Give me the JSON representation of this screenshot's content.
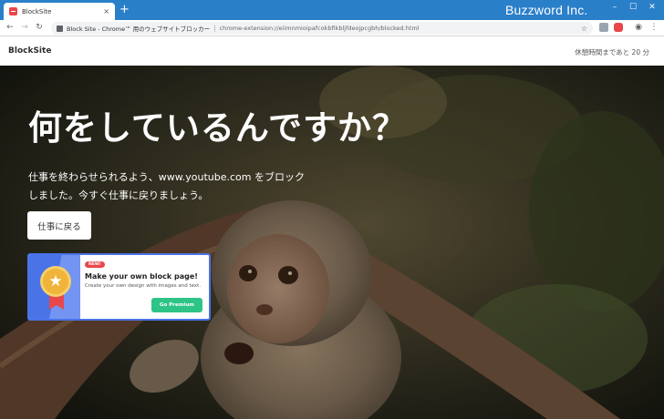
{
  "browser": {
    "tab_title": "BlockSite",
    "tab_close": "×",
    "new_tab": "+",
    "brand": "Buzzword Inc.",
    "window_controls": {
      "minimize": "–",
      "maximize": "☐",
      "close": "✕"
    },
    "nav": {
      "back": "←",
      "forward": "→",
      "reload": "↻"
    },
    "omnibox": {
      "site_label": "Block Site - Chrome™ 用のウェブサイトブロッカー",
      "separator": "|",
      "url": "chrome-extension://eiimnmioipafcokbfikbljfdeojpcgbh/blocked.html",
      "star": "☆"
    },
    "toolbar_icons": {
      "profile": "◉",
      "menu": "⋮"
    }
  },
  "header": {
    "logo": "BlockSite",
    "break_timer": "休憩時間まであと 20 分"
  },
  "hero": {
    "headline": "何をしているんですか？",
    "message": "仕事を終わらせられるよう、www.youtube.com をブロックしました。今すぐ仕事に戻りましょう。",
    "back_button": "仕事に戻る"
  },
  "promo": {
    "badge": "NEW!",
    "title": "Make your own block page!",
    "subtitle": "Create your own design with images and text.",
    "button": "Go Premium",
    "medal_star": "★"
  },
  "colors": {
    "titlebar": "#2a7fc9",
    "promo_accent": "#4a73e8",
    "premium_button": "#2ec487",
    "badge": "#e8474c"
  },
  "icons": {
    "tab_favicon": "blocksite-icon",
    "extension_1": "extension-icon",
    "extension_2": "blocksite-shield-icon"
  }
}
